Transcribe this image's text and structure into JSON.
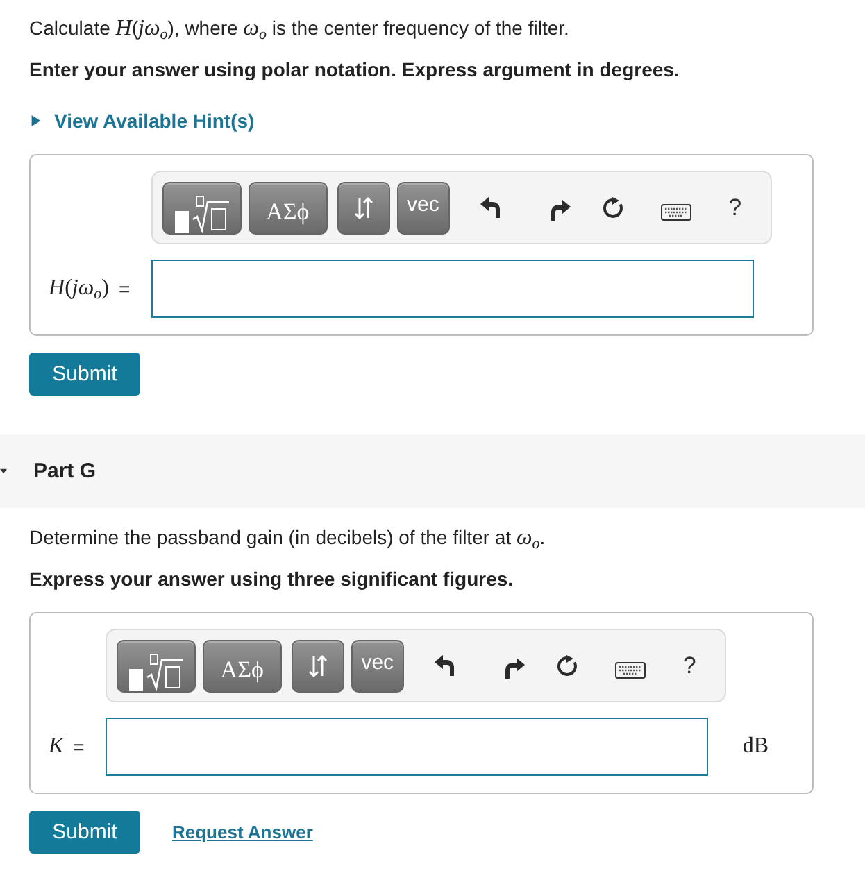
{
  "parts": [
    {
      "prompt": "Calculate *H*(*jω*$_{o}$), where *ω*$_{o}$ is the center frequency of the filter.",
      "instruction": "Enter your answer using polar notation. Express argument in degrees.",
      "hint": {
        "label": "View Available Hint(s)",
        "expanded": false
      },
      "answer": {
        "label": "*H*(*jω*$_{o}$)",
        "sign": "=",
        "toolbar": {
          "symbols": "ΑΣϕ",
          "vector": "vec",
          "help": "?"
        }
      },
      "submit": "Submit"
    },
    {
      "title": "Part G",
      "expanded": true,
      "prompt": "Determine the passband gain (in decibels) of the filter at *ω*$_{o}$.",
      "instruction": "Express your answer using three significant figures.",
      "answer": {
        "label": "*K*",
        "sign": "=",
        "unit": "dB",
        "toolbar": {
          "symbols": "ΑΣϕ",
          "vector": "vec",
          "help": "?"
        }
      },
      "submit": "Submit",
      "request_answer": "Request Answer"
    }
  ]
}
